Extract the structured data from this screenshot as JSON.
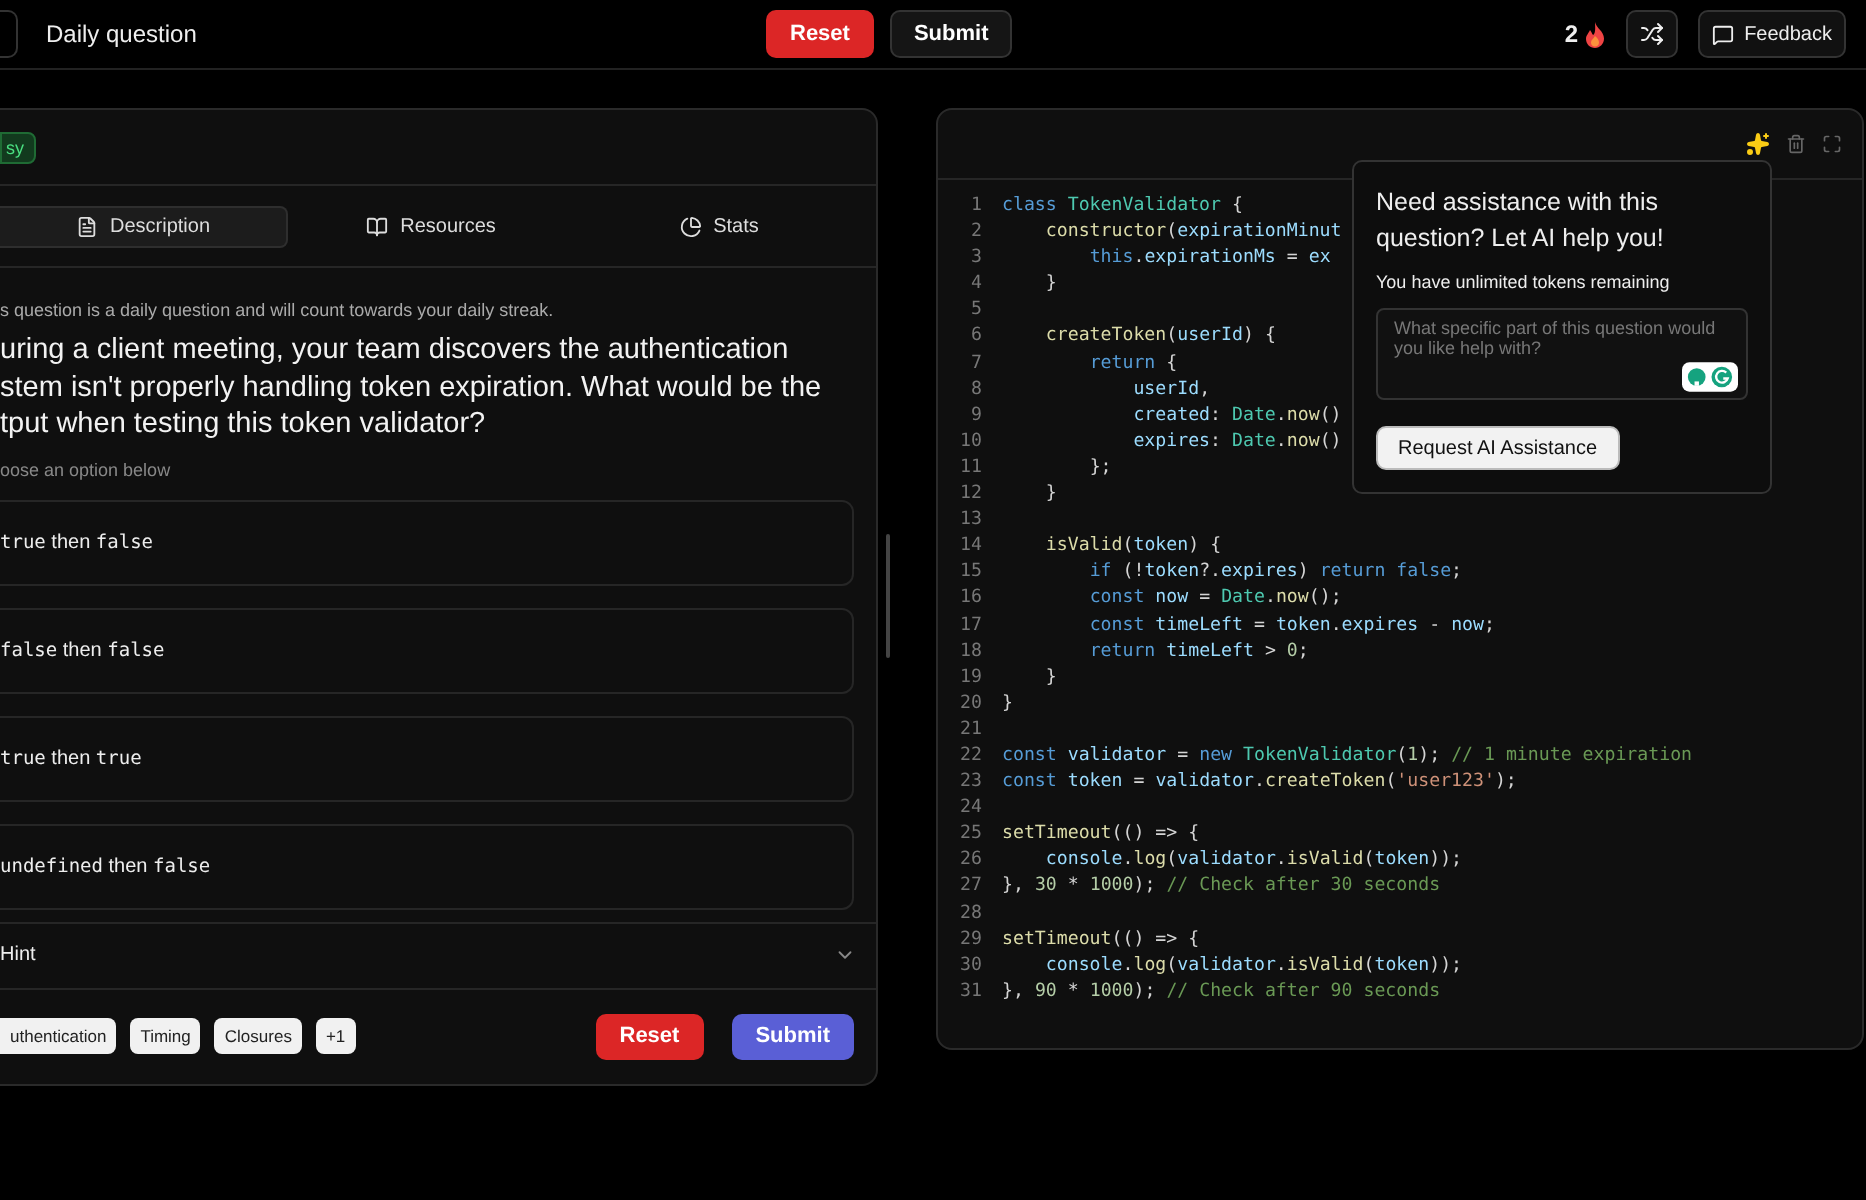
{
  "topbar": {
    "title": "Daily question",
    "reset": "Reset",
    "submit": "Submit",
    "streak": "2",
    "feedback": "Feedback"
  },
  "question_panel": {
    "difficulty": "sy",
    "tabs": [
      {
        "label": "Description",
        "selected": true
      },
      {
        "label": "Resources",
        "selected": false
      },
      {
        "label": "Stats",
        "selected": false
      }
    ],
    "notice": "s question is a daily question and will count towards your daily streak.",
    "question_lines": [
      "uring a client meeting, your team discovers the authentication",
      "stem isn't properly handling token expiration. What would be the",
      "tput when testing this token validator?"
    ],
    "prompt": "oose an option below",
    "options": [
      {
        "parts": [
          "true",
          " then ",
          "false"
        ],
        "selected": false
      },
      {
        "parts": [
          "false",
          " then ",
          "false"
        ],
        "selected": false
      },
      {
        "parts": [
          "true",
          " then ",
          "true"
        ],
        "selected": false
      },
      {
        "parts": [
          "undefined",
          " then ",
          "false"
        ],
        "selected": false
      }
    ],
    "hint": {
      "label": "Hint",
      "expanded": false
    },
    "tags": [
      "uthentication",
      "Timing",
      "Closures",
      "+1"
    ],
    "reset": "Reset",
    "submit": "Submit"
  },
  "code_editor": {
    "lines": [
      {
        "number": "1",
        "code": "class TokenValidator {"
      },
      {
        "number": "2",
        "code": "    constructor(expirationMinut"
      },
      {
        "number": "3",
        "code": "        this.expirationMs = ex"
      },
      {
        "number": "4",
        "code": "    }"
      },
      {
        "number": "5"
      },
      {
        "number": "6",
        "code": "    createToken(userId) {"
      },
      {
        "number": "7",
        "code": "        return {"
      },
      {
        "number": "8",
        "code": "            userId,"
      },
      {
        "number": "9",
        "code": "            created: Date.now()"
      },
      {
        "number": "10",
        "code": "            expires: Date.now()"
      },
      {
        "number": "11",
        "code": "        };"
      },
      {
        "number": "12",
        "code": "    }"
      },
      {
        "number": "13"
      },
      {
        "number": "14",
        "code": "    isValid(token) {"
      },
      {
        "number": "15",
        "code": "        if (!token?.expires) return false;"
      },
      {
        "number": "16",
        "code": "        const now = Date.now();"
      },
      {
        "number": "17",
        "code": "        const timeLeft = token.expires - now;"
      },
      {
        "number": "18",
        "code": "        return timeLeft > 0;"
      },
      {
        "number": "19",
        "code": "    }"
      },
      {
        "number": "20",
        "code": "}"
      },
      {
        "number": "21"
      },
      {
        "number": "22",
        "code": "const validator = new TokenValidator(1); // 1 minute expiration"
      },
      {
        "number": "23",
        "code": "const token = validator.createToken('user123');"
      },
      {
        "number": "24"
      },
      {
        "number": "25",
        "code": "setTimeout(() => {"
      },
      {
        "number": "26",
        "code": "    console.log(validator.isValid(token));"
      },
      {
        "number": "27",
        "code": "}, 30 * 1000); // Check after 30 seconds"
      },
      {
        "number": "28"
      },
      {
        "number": "29",
        "code": "setTimeout(() => {"
      },
      {
        "number": "30",
        "code": "    console.log(validator.isValid(token));"
      },
      {
        "number": "31",
        "code": "}, 90 * 1000); // Check after 90 seconds"
      }
    ]
  },
  "ai_popover": {
    "title": "Need assistance with this question? Let AI help you!",
    "tokens": "You have unlimited tokens remaining",
    "placeholder": "What specific part of this question would you like help with?",
    "button": "Request AI Assistance"
  }
}
